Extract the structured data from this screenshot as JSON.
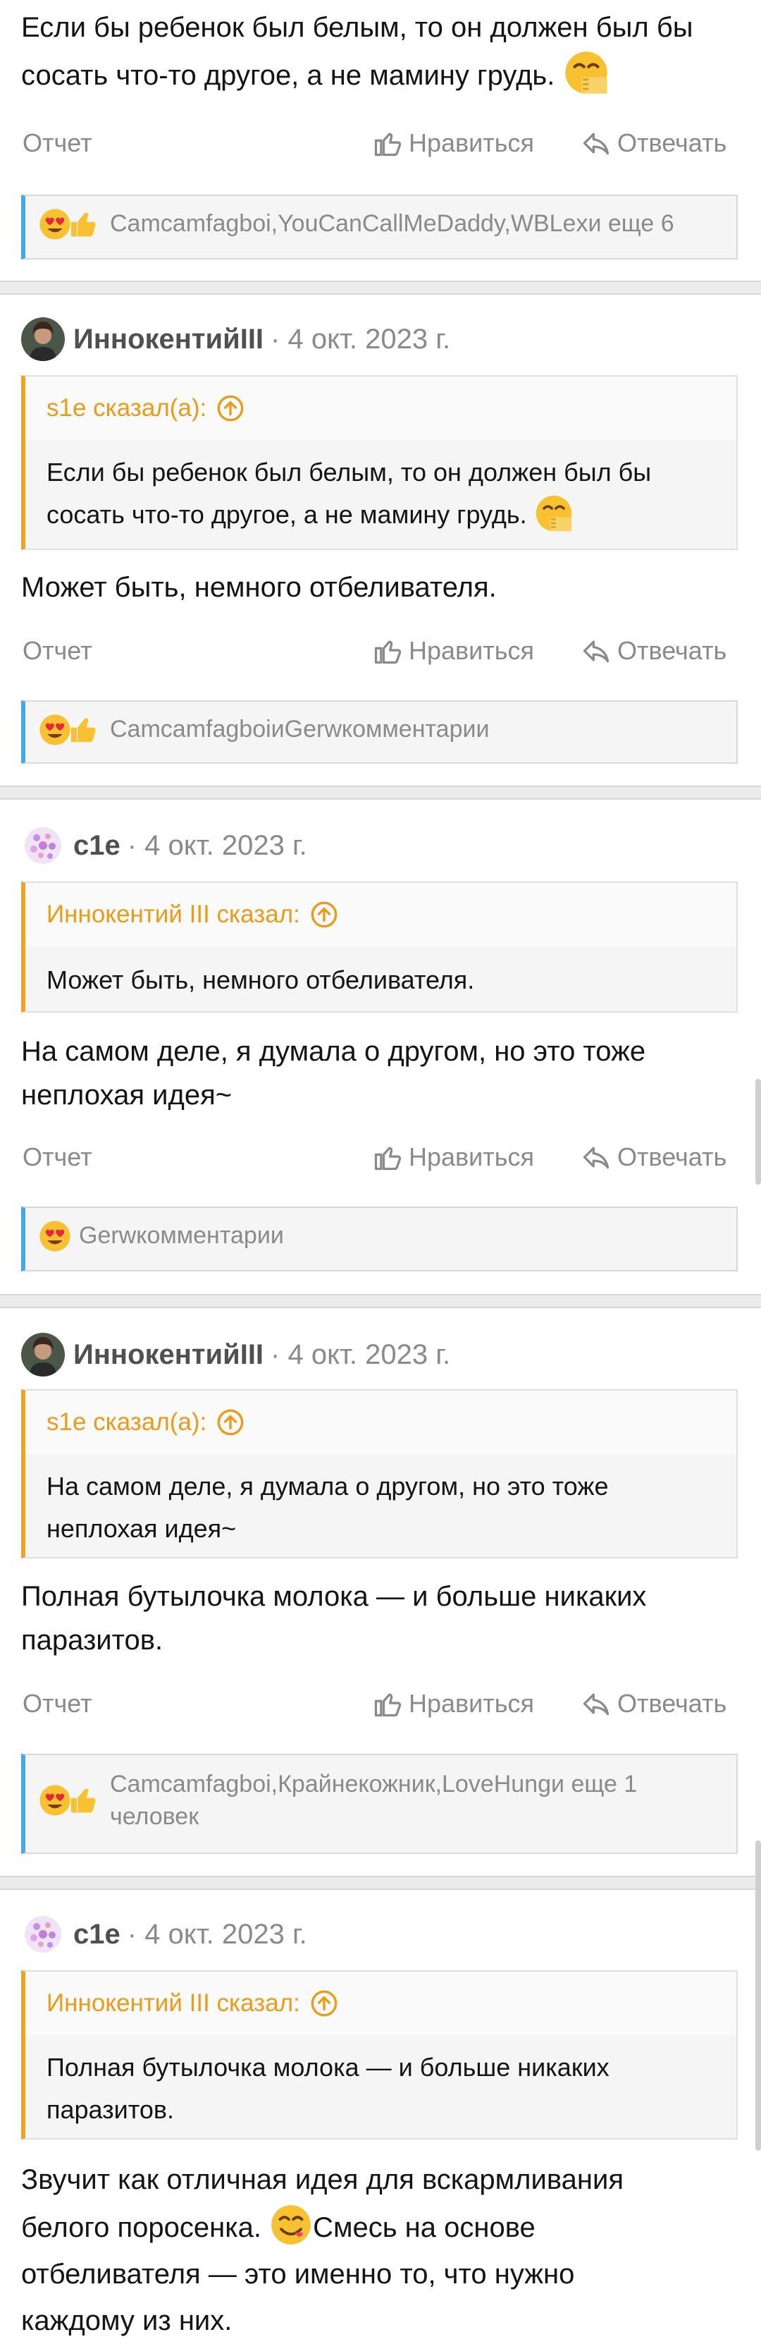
{
  "colors": {
    "accent_blue": "#47a7eb",
    "quote_orange": "#f0a226",
    "muted_text": "#8a8a8a"
  },
  "labels": {
    "report": "Отчет",
    "like": "Нравиться",
    "reply": "Отвечать"
  },
  "posts": [
    {
      "body": "Если бы ребенок был белым, то он должен был бы сосать что-то другое, а не мамину грудь.",
      "reactions": {
        "text": "Camcamfagboi,YouCanCallMeDaddy,WBLexи еще 6",
        "emojis": [
          "heart-eyes",
          "thumbs-up"
        ]
      }
    },
    {
      "author": "ИннокентийIII",
      "date": "· 4 окт. 2023 г.",
      "quote_head": "s1e сказал(а):",
      "quote_body": "Если бы ребенок был белым, то он должен был бы сосать что-то другое, а не мамину грудь.",
      "body": "Может быть, немного отбеливателя.",
      "reactions": {
        "text": "CamcamfagboiиGerwкомментарии",
        "emojis": [
          "heart-eyes",
          "thumbs-up"
        ]
      }
    },
    {
      "author": "c1e",
      "date": "· 4 окт. 2023 г.",
      "quote_head": "Иннокентий III сказал:",
      "quote_body": "Может быть, немного отбеливателя.",
      "body": "На самом деле, я думала о другом, но это тоже неплохая идея~",
      "reactions": {
        "text": "Gerwкомментарии",
        "emojis": [
          "heart-eyes"
        ]
      }
    },
    {
      "author": "ИннокентийIII",
      "date": "· 4 окт. 2023 г.",
      "quote_head": "s1e сказал(а):",
      "quote_body": "На самом деле, я думала о другом, но это тоже неплохая идея~",
      "body": "Полная бутылочка молока — и больше никаких паразитов.",
      "reactions": {
        "text": "Camcamfagboi,Крайнекожник,LoveHungи еще 1 человек",
        "emojis": [
          "heart-eyes",
          "thumbs-up"
        ]
      }
    },
    {
      "author": "c1e",
      "date": "· 4 окт. 2023 г.",
      "quote_head": "Иннокентий III сказал:",
      "quote_body": "Полная бутылочка молока — и больше никаких паразитов.",
      "body_line1": "Звучит как отличная идея для вскармливания",
      "body_line2a": "белого поросенка.",
      "body_line2b": "Смесь на основе",
      "body_line3": "отбеливателя — это именно то, что нужно",
      "body_line4": "каждому из них."
    }
  ]
}
